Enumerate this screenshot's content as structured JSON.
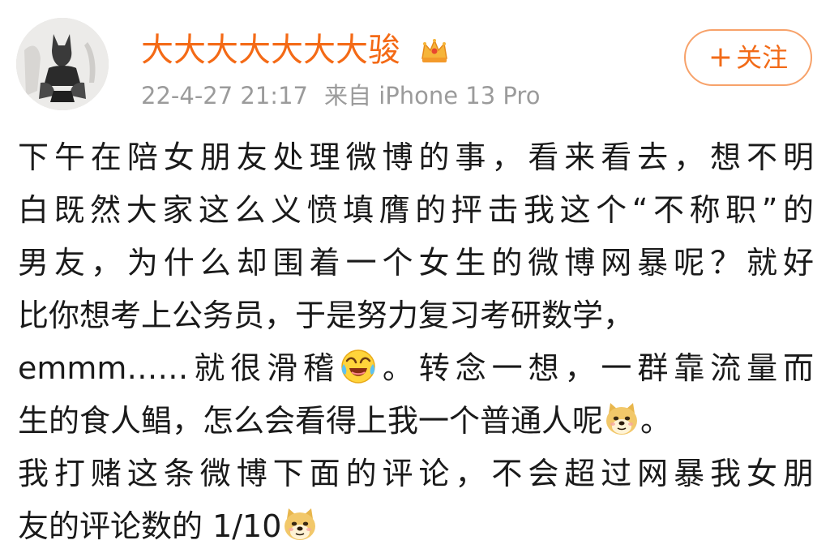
{
  "user": {
    "name": "大大大大大大大骏",
    "badge_icon": "crown-icon",
    "timestamp": "22-4-27 21:17",
    "source": "来自 iPhone 13 Pro",
    "avatar_icon": "avatar-illustration"
  },
  "follow_button": {
    "label": "关注",
    "icon": "plus-icon",
    "color": "#f26b18"
  },
  "post": {
    "lines": [
      "下午在陪女朋友处理微博的事，看来看去，想不明",
      "白既然大家这么义愤填膺的抨击我这个“不称职”的",
      "男友，为什么却围着一个女生的微博网暴呢？就好",
      "比你想考上公务员，于是努力复习考研数学，",
      {
        "before": "emmm……就很滑稽",
        "emoji": "laughing-crying-emoji",
        "after": "。转念一想，一群靠流量而"
      },
      {
        "before": "生的食人鲳，怎么会看得上我一个普通人呢",
        "emoji": "doge-emoji",
        "after": "。"
      },
      "我打赌这条微博下面的评论，不会超过网暴我女朋",
      {
        "before": "友的评论数的 1/10",
        "emoji": "doge-emoji",
        "after": ""
      }
    ]
  },
  "colors": {
    "username": "#f46a16",
    "meta": "#9b9b9b",
    "text": "#1a1a1a",
    "button_border": "#f7a26a"
  }
}
